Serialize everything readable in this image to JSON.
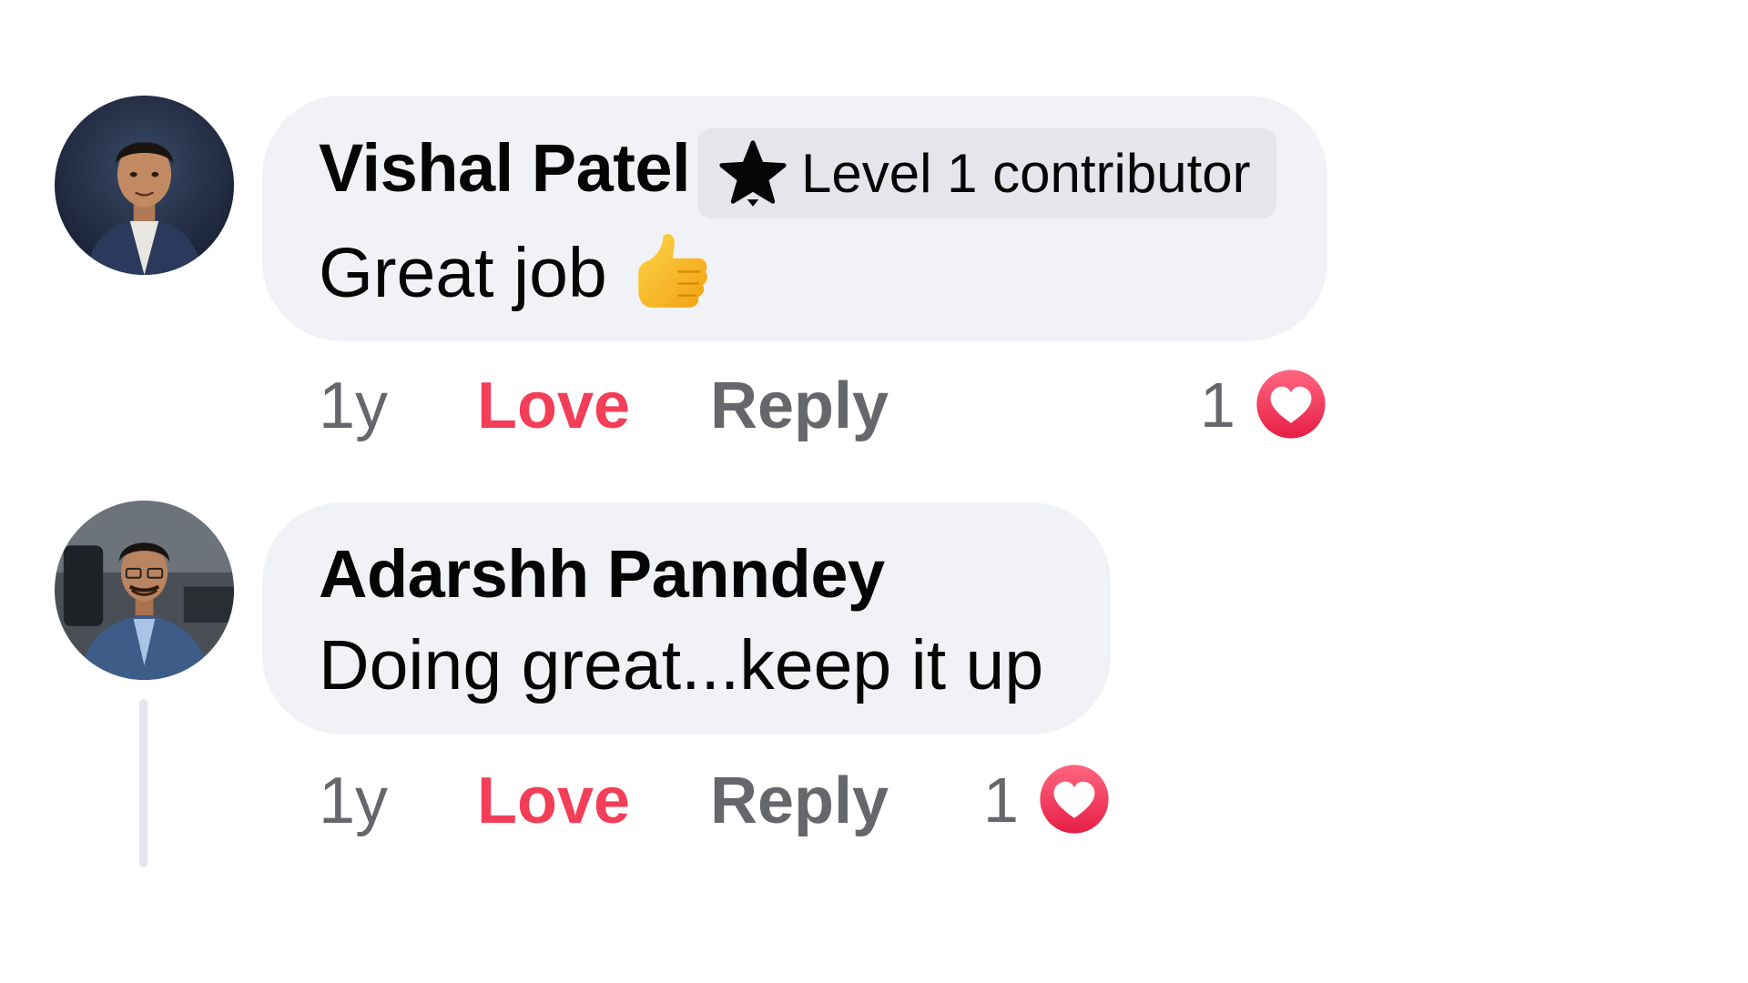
{
  "comments": [
    {
      "author": "Vishal Patel",
      "badge": {
        "icon": "star-icon",
        "label": "Level 1 contributor"
      },
      "text": "Great job",
      "emoji": "thumbs-up-icon",
      "time": "1y",
      "love_label": "Love",
      "reply_label": "Reply",
      "reaction_count": "1",
      "reaction_icon": "heart-icon"
    },
    {
      "author": "Adarshh Panndey",
      "text": "Doing great...keep it up",
      "time": "1y",
      "love_label": "Love",
      "reply_label": "Reply",
      "reaction_count": "1",
      "reaction_icon": "heart-icon"
    }
  ],
  "colors": {
    "bubble": "#f0f2f5",
    "badge": "#e4e6eb",
    "love": "#f33e58",
    "secondary_text": "#65676b",
    "heart": "#f33e58"
  }
}
